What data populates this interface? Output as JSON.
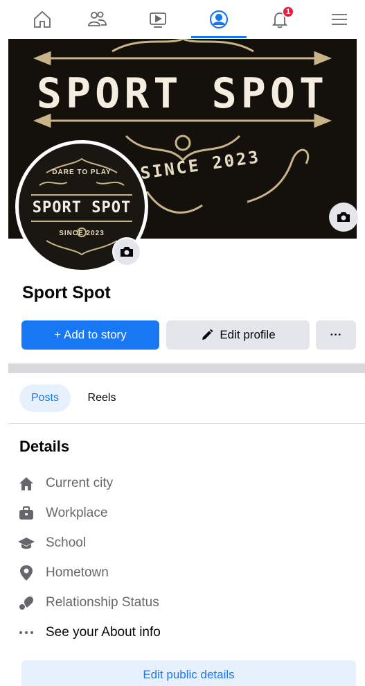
{
  "nav": {
    "items": [
      "home-icon",
      "friends-icon",
      "video-icon",
      "profile-icon",
      "notifications-icon",
      "menu-icon"
    ],
    "notification_count": "1",
    "active": "profile"
  },
  "cover": {
    "title": "SPORT SPOT",
    "since": "SINCE 2023"
  },
  "avatar": {
    "top_text": "DARE TO PLAY",
    "title": "SPORT SPOT",
    "since": "SINCE 2023"
  },
  "profile": {
    "name": "Sport Spot"
  },
  "actions": {
    "add_story": "+ Add to story",
    "edit_profile": "Edit profile",
    "more": "···"
  },
  "tabs": {
    "posts": "Posts",
    "reels": "Reels"
  },
  "details": {
    "title": "Details",
    "items": [
      {
        "label": "Current city",
        "icon": "home-icon"
      },
      {
        "label": "Workplace",
        "icon": "briefcase-icon"
      },
      {
        "label": "School",
        "icon": "graduation-cap-icon"
      },
      {
        "label": "Hometown",
        "icon": "location-pin-icon"
      },
      {
        "label": "Relationship Status",
        "icon": "heart-icon"
      },
      {
        "label": "See your About info",
        "icon": "more-dots-icon"
      }
    ],
    "edit_button": "Edit public details"
  },
  "colors": {
    "accent": "#1877f2",
    "badge": "#e41e3f",
    "secondary_button": "#e4e6eb",
    "muted_text": "#65676b"
  }
}
